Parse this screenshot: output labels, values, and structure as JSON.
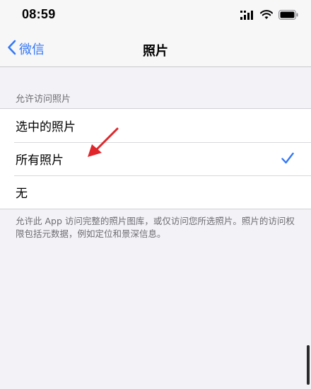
{
  "status_bar": {
    "time": "08:59",
    "icons": [
      "cellular-signal-icon",
      "wifi-icon",
      "battery-icon"
    ]
  },
  "nav": {
    "back_label": "微信",
    "title": "照片"
  },
  "section": {
    "header": "允许访问照片",
    "options": [
      {
        "label": "选中的照片",
        "selected": false
      },
      {
        "label": "所有照片",
        "selected": true
      },
      {
        "label": "无",
        "selected": false
      }
    ],
    "footer": "允许此 App 访问完整的照片图库，或仅访问您所选照片。照片的访问权限包括元数据，例如定位和景深信息。"
  },
  "colors": {
    "accent": "#3478f6",
    "background": "#f2f2f7",
    "annotation": "#e0262b"
  }
}
